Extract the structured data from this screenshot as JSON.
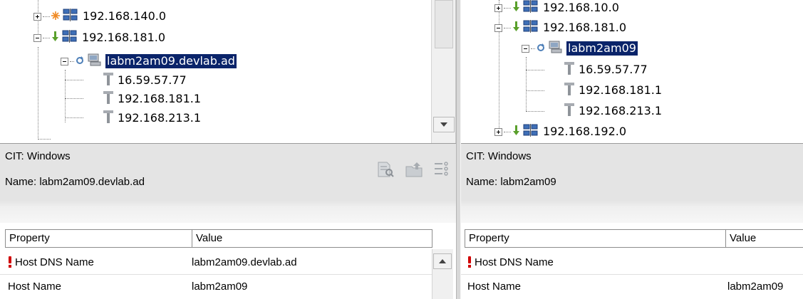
{
  "left": {
    "tree": {
      "nodes": [
        {
          "label": "192.168.140.0",
          "icon": "network-icon",
          "status": "sun-status-icon",
          "expanded": false
        },
        {
          "label": "192.168.181.0",
          "icon": "network-icon",
          "status": "down-arrow-status-icon",
          "expanded": true
        },
        {
          "label": "labm2am09.devlab.ad",
          "icon": "host-icon",
          "status": "refresh-status-icon",
          "expanded": true,
          "selected": true
        },
        {
          "label": "16.59.57.77",
          "icon": "ip-icon"
        },
        {
          "label": "192.168.181.1",
          "icon": "ip-icon"
        },
        {
          "label": "192.168.213.1",
          "icon": "ip-icon"
        }
      ]
    },
    "info": {
      "cit": "CIT: Windows",
      "name": "Name: labm2am09.devlab.ad",
      "tools": [
        "find-document-icon",
        "export-folder-icon",
        "list-options-icon"
      ]
    },
    "grid": {
      "columns": [
        "Property",
        "Value"
      ],
      "rows": [
        {
          "property": "Host DNS Name",
          "value": "labm2am09.devlab.ad",
          "flag": "required-icon"
        },
        {
          "property": "Host Name",
          "value": "labm2am09"
        }
      ]
    }
  },
  "right": {
    "tree": {
      "nodes": [
        {
          "label": "192.168.10.0",
          "icon": "network-icon",
          "status": "down-arrow-status-icon",
          "expanded": false
        },
        {
          "label": "192.168.181.0",
          "icon": "network-icon",
          "status": "down-arrow-status-icon",
          "expanded": true
        },
        {
          "label": "labm2am09",
          "icon": "host-icon",
          "status": "refresh-status-icon",
          "expanded": true,
          "selected": true
        },
        {
          "label": "16.59.57.77",
          "icon": "ip-icon"
        },
        {
          "label": "192.168.181.1",
          "icon": "ip-icon"
        },
        {
          "label": "192.168.213.1",
          "icon": "ip-icon"
        },
        {
          "label": "192.168.192.0",
          "icon": "network-icon",
          "status": "down-arrow-status-icon",
          "expanded": false
        }
      ]
    },
    "info": {
      "cit": "CIT: Windows",
      "name": "Name: labm2am09"
    },
    "grid": {
      "columns": [
        "Property",
        "Value"
      ],
      "rows": [
        {
          "property": "Host DNS Name",
          "value": "",
          "flag": "required-icon"
        },
        {
          "property": "Host Name",
          "value": "labm2am09"
        }
      ]
    }
  },
  "colors": {
    "selection": "#0a246a",
    "status_green": "#5aa02c",
    "status_orange": "#f08a24",
    "required_red": "#d00000"
  }
}
